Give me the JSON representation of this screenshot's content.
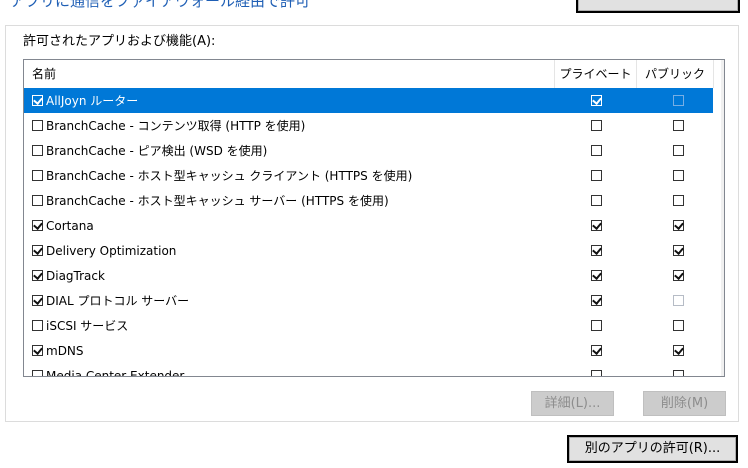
{
  "top": {
    "heading": "アプリに通信をファイアウォール経由で許可"
  },
  "section_label": "許可されたアプリおよび機能(A):",
  "list": {
    "headers": {
      "name": "名前",
      "private": "プライベート",
      "public": "パブリック"
    },
    "rows": [
      {
        "name": "AllJoyn ルーター",
        "enabled": true,
        "private": true,
        "public": false,
        "public_disabled": true,
        "selected": true
      },
      {
        "name": "BranchCache - コンテンツ取得 (HTTP を使用)",
        "enabled": false,
        "private": false,
        "public": false,
        "public_disabled": false,
        "selected": false
      },
      {
        "name": "BranchCache - ピア検出 (WSD を使用)",
        "enabled": false,
        "private": false,
        "public": false,
        "public_disabled": false,
        "selected": false
      },
      {
        "name": "BranchCache - ホスト型キャッシュ クライアント (HTTPS を使用)",
        "enabled": false,
        "private": false,
        "public": false,
        "public_disabled": false,
        "selected": false
      },
      {
        "name": "BranchCache - ホスト型キャッシュ サーバー (HTTPS を使用)",
        "enabled": false,
        "private": false,
        "public": false,
        "public_disabled": false,
        "selected": false
      },
      {
        "name": "Cortana",
        "enabled": true,
        "private": true,
        "public": true,
        "public_disabled": false,
        "selected": false
      },
      {
        "name": "Delivery Optimization",
        "enabled": true,
        "private": true,
        "public": true,
        "public_disabled": false,
        "selected": false
      },
      {
        "name": "DiagTrack",
        "enabled": true,
        "private": true,
        "public": true,
        "public_disabled": false,
        "selected": false
      },
      {
        "name": "DIAL プロトコル サーバー",
        "enabled": true,
        "private": true,
        "public": false,
        "public_disabled": true,
        "selected": false
      },
      {
        "name": "iSCSI サービス",
        "enabled": false,
        "private": false,
        "public": false,
        "public_disabled": false,
        "selected": false
      },
      {
        "name": "mDNS",
        "enabled": true,
        "private": true,
        "public": true,
        "public_disabled": false,
        "selected": false
      },
      {
        "name": "Media Center Extender",
        "enabled": false,
        "private": false,
        "public": false,
        "public_disabled": false,
        "selected": false
      }
    ]
  },
  "scrollbar": {
    "up_icon": "chevron-up-icon",
    "down_icon": "chevron-down-icon"
  },
  "buttons": {
    "details": "詳細(L)...",
    "delete": "削除(M)",
    "allow_another": "別のアプリの許可(R)..."
  },
  "colors": {
    "selection": "#0078d7",
    "heading": "#1f5fb5"
  }
}
